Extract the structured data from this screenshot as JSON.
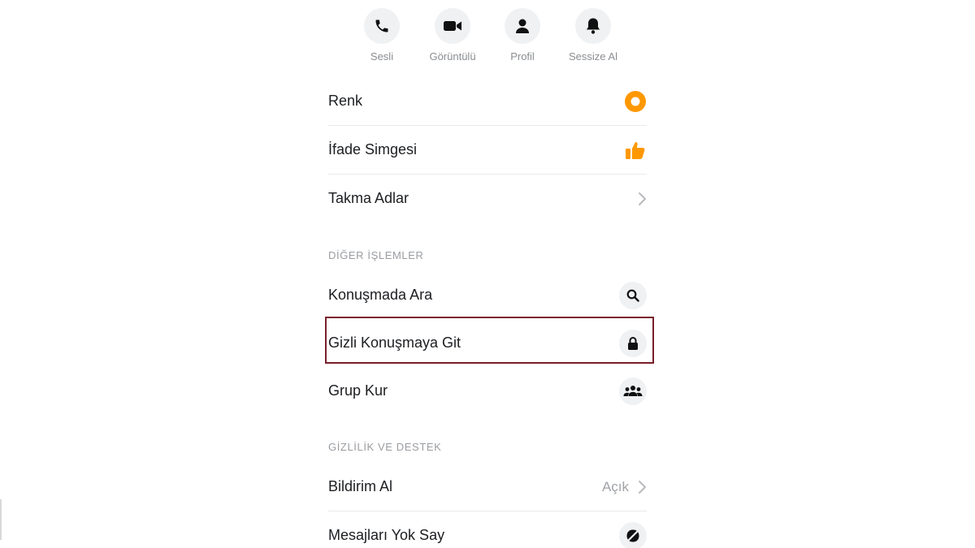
{
  "actions": [
    {
      "label": "Sesli",
      "icon": "phone-icon"
    },
    {
      "label": "Görüntülü",
      "icon": "video-camera-icon"
    },
    {
      "label": "Profil",
      "icon": "person-icon"
    },
    {
      "label": "Sessize Al",
      "icon": "bell-icon"
    }
  ],
  "customize": {
    "color_label": "Renk",
    "emoji_label": "İfade Simgesi",
    "nicknames_label": "Takma Adlar"
  },
  "more_actions": {
    "header": "DİĞER İŞLEMLER",
    "search_label": "Konuşmada Ara",
    "secret_label": "Gizli Konuşmaya Git",
    "group_label": "Grup Kur"
  },
  "privacy": {
    "header": "GİZLİLİK VE DESTEK",
    "notifications_label": "Bildirim Al",
    "notifications_value": "Açık",
    "ignore_label": "Mesajları Yok Say"
  },
  "colors": {
    "accent": "#ff9800",
    "highlight_border": "#7a1f2b",
    "icon_bg": "#f0f1f3",
    "muted_text": "#8a8d91"
  }
}
